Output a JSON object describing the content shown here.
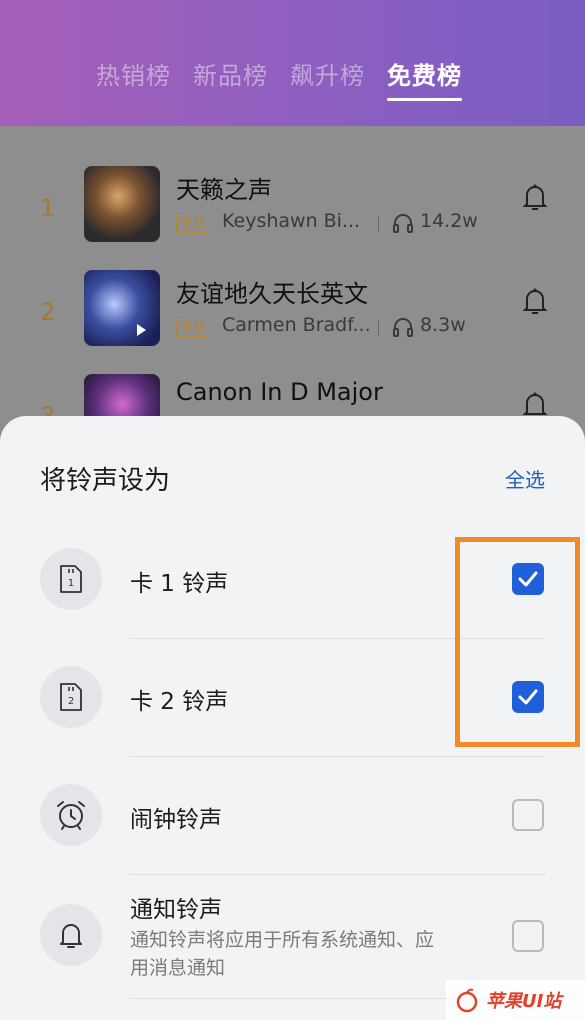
{
  "tabs": [
    {
      "label": "热销榜",
      "active": false
    },
    {
      "label": "新品榜",
      "active": false
    },
    {
      "label": "飙升榜",
      "active": false
    },
    {
      "label": "免费榜",
      "active": true
    }
  ],
  "songs": [
    {
      "rank": "1",
      "title": "天籁之声",
      "badge": "免费",
      "artist": "Keyshawn Bi...",
      "plays": "14.2w"
    },
    {
      "rank": "2",
      "title": "友谊地久天长英文",
      "badge": "免费",
      "artist": "Carmen Bradf...",
      "plays": "8.3w"
    },
    {
      "rank": "3",
      "title": "Canon In D Major"
    }
  ],
  "sheet": {
    "title": "将铃声设为",
    "select_all": "全选",
    "options": [
      {
        "label": "卡 1 铃声",
        "icon": "sim-card-1-icon",
        "sim_number": "1",
        "checked": true
      },
      {
        "label": "卡 2 铃声",
        "icon": "sim-card-2-icon",
        "sim_number": "2",
        "checked": true
      },
      {
        "label": "闹钟铃声",
        "icon": "alarm-clock-icon",
        "checked": false
      },
      {
        "label": "通知铃声",
        "desc": "通知铃声将应用于所有系统通知、应用消息通知",
        "icon": "bell-icon",
        "checked": false
      }
    ]
  },
  "watermark": {
    "text": "苹果UI站"
  },
  "colors": {
    "accent": "#1f5fd8",
    "highlight": "#f28a2a",
    "badge": "#b8862e",
    "link": "#1f5fbf"
  }
}
